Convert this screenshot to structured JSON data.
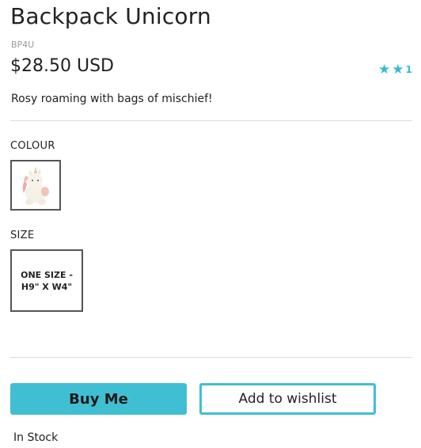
{
  "product": {
    "title": "Backpack Unicorn",
    "sku": "BP4U",
    "price": "$28.50 USD",
    "description": "Rosy roaming with bags of mischief!",
    "rating": {
      "stars_shown": 2,
      "count_label": "1",
      "color": "#36bccf"
    }
  },
  "options": {
    "colour_label": "COLOUR",
    "colour_swatch_icon": "unicorn-plush-thumbnail",
    "size_label": "SIZE",
    "size_value": "ONE SIZE - H9\" X W4\""
  },
  "actions": {
    "buy_label": "Buy Me",
    "wishlist_label": "Add to wishlist",
    "accent_color": "#41bfd2"
  },
  "availability": {
    "status": "In Stock"
  }
}
